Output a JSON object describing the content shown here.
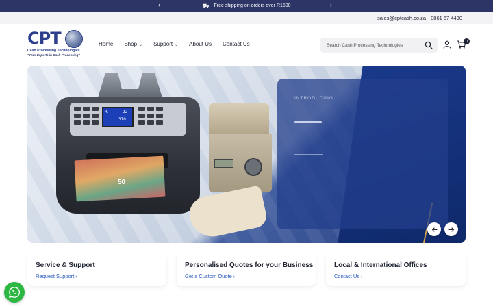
{
  "announcement": {
    "text": "Free shipping on orders over R1500",
    "prev_arrow": "‹",
    "next_arrow": "›"
  },
  "contact": {
    "email": "sales@cptcash.co.za",
    "phone": "0861 67 4490"
  },
  "logo": {
    "letters": "CPT",
    "company": "Cash Processing Technologies",
    "tagline": "\"Your Experts in Cash Processing\""
  },
  "nav": {
    "items": [
      {
        "label": "Home",
        "has_dropdown": false
      },
      {
        "label": "Shop",
        "has_dropdown": true
      },
      {
        "label": "Support",
        "has_dropdown": true
      },
      {
        "label": "About Us",
        "has_dropdown": false
      },
      {
        "label": "Contact Us",
        "has_dropdown": false
      }
    ]
  },
  "search": {
    "placeholder": "Search Cash Processing Technologies",
    "icon": "search-icon"
  },
  "cart": {
    "count": "0",
    "icon": "cart-icon"
  },
  "account": {
    "icon": "account-icon"
  },
  "hero": {
    "intro_label": "INTRODUCING",
    "display_values": {
      "screen_mode": "R",
      "screen_count": "22",
      "screen_total": "370",
      "note_value": "50"
    },
    "prev_icon": "arrow-left-icon",
    "next_icon": "arrow-right-icon"
  },
  "features": [
    {
      "title": "Service & Support",
      "link": "Request Support"
    },
    {
      "title": "Personalised Quotes for your Business",
      "link": "Get a Custom Quote"
    },
    {
      "title": "Local & International Offices",
      "link": "Contact Us"
    }
  ],
  "colors": {
    "announcement_bg": "#2c3566",
    "brand_blue": "#2c3e8c",
    "link_blue": "#2b5bbd",
    "whatsapp_green": "#2bb742"
  }
}
